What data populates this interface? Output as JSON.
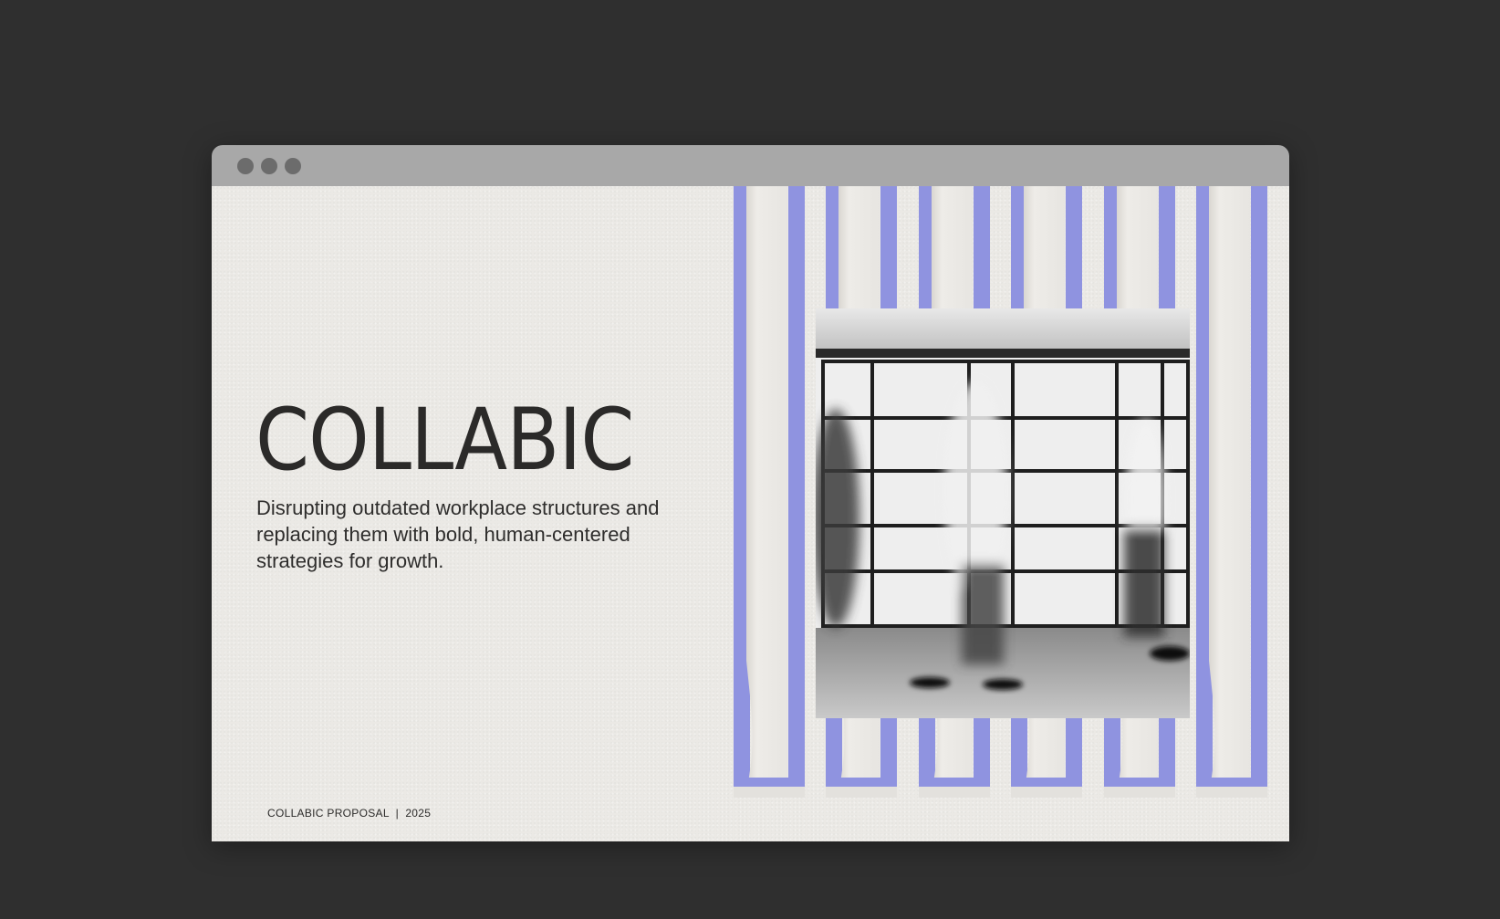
{
  "window": {
    "titlebar_dots": [
      "window-dot",
      "window-dot",
      "window-dot"
    ]
  },
  "slide": {
    "brand_name": "COLLABIC",
    "tagline": "Disrupting outdated workplace structures and replacing them with bold, human-centered strategies for growth.",
    "footer": "COLLABIC PROPOSAL  |  2025"
  },
  "colors": {
    "page_background": "#2f2f2f",
    "titlebar": "#a8a8a8",
    "window_dots": "#6c6c6c",
    "paper": "#ebe9e5",
    "accent_stripe": "#8f93e0",
    "text": "#2b2a29"
  },
  "photo": {
    "description_icon": "office-photo"
  }
}
